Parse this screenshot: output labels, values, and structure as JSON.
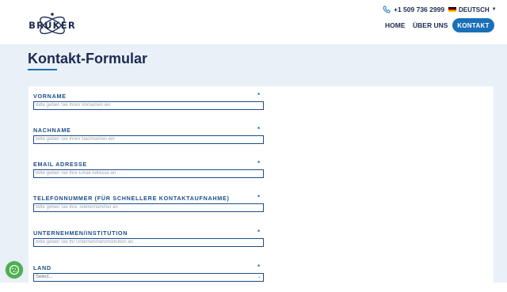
{
  "header": {
    "logo_text": "BRUKER",
    "phone": "+1 509 736 2999",
    "language": "DEUTSCH",
    "nav": {
      "home": "HOME",
      "about": "ÜBER UNS",
      "contact": "KONTAKT"
    }
  },
  "page": {
    "title": "Kontakt-Formular"
  },
  "form": {
    "fields": [
      {
        "label": "VORNAME",
        "required": "*",
        "placeholder": "Bitte geben Sie Ihren Vornamen ein"
      },
      {
        "label": "NACHNAME",
        "required": "*",
        "placeholder": "Bitte geben Sie Ihren Nachnamen ein"
      },
      {
        "label": "EMAIL ADRESSE",
        "required": "*",
        "placeholder": "Bitte geben Sie Ihre Email Adresse an"
      },
      {
        "label": "TELEFONNUMMER (FÜR SCHNELLERE KONTAKTAUFNAHME)",
        "required": "*",
        "placeholder": "Bitte geben Sie Ihre Telefonnummer an"
      },
      {
        "label": "UNTERNEHMEN/INSTITUTION",
        "required": "*",
        "placeholder": "Bitte geben Sie Ihr Unternehmen/Institution an"
      },
      {
        "label": "LAND",
        "required": "*",
        "selected": "Select..."
      }
    ]
  },
  "colors": {
    "brand_blue": "#1a6fb9",
    "navy": "#1d2b52",
    "page_bg": "#e9f0f7",
    "cookie_green": "#4caf50"
  },
  "icons": {
    "phone": "phone-icon",
    "flag": "german-flag-icon",
    "cookie": "cookie-icon"
  }
}
